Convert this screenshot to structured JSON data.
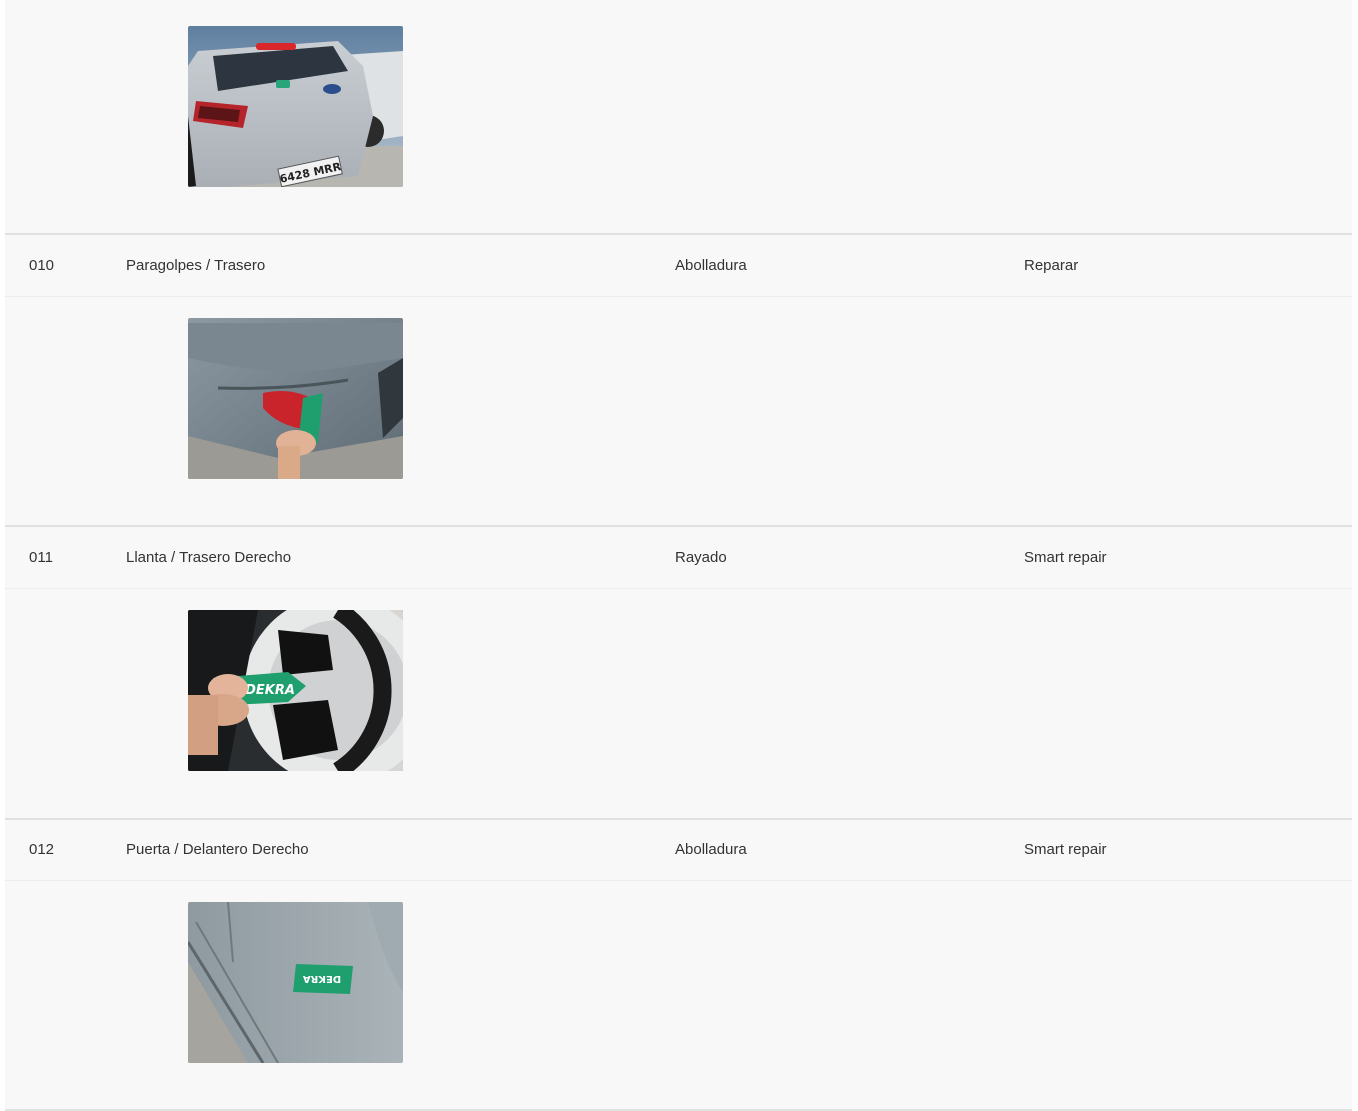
{
  "damages": [
    {
      "photo_alt": "rear-car-photo",
      "number": null,
      "part": null,
      "damage": null,
      "action": null
    },
    {
      "number": "010",
      "part": "Paragolpes / Trasero",
      "damage": "Abolladura",
      "action": "Reparar",
      "photo_alt": "bumper-photo"
    },
    {
      "number": "011",
      "part": "Llanta / Trasero Derecho",
      "damage": "Rayado",
      "action": "Smart repair",
      "photo_alt": "wheel-photo"
    },
    {
      "number": "012",
      "part": "Puerta / Delantero Derecho",
      "damage": "Abolladura",
      "action": "Smart repair",
      "photo_alt": "door-photo"
    }
  ],
  "photo_labels": {
    "plate_text": "6428 MRR",
    "tag_text": "DEKRA"
  },
  "colors": {
    "background": "#f8f8f8",
    "separator": "#e1e1e1",
    "text": "#333333",
    "dekra_green": "#1f9e6e"
  }
}
